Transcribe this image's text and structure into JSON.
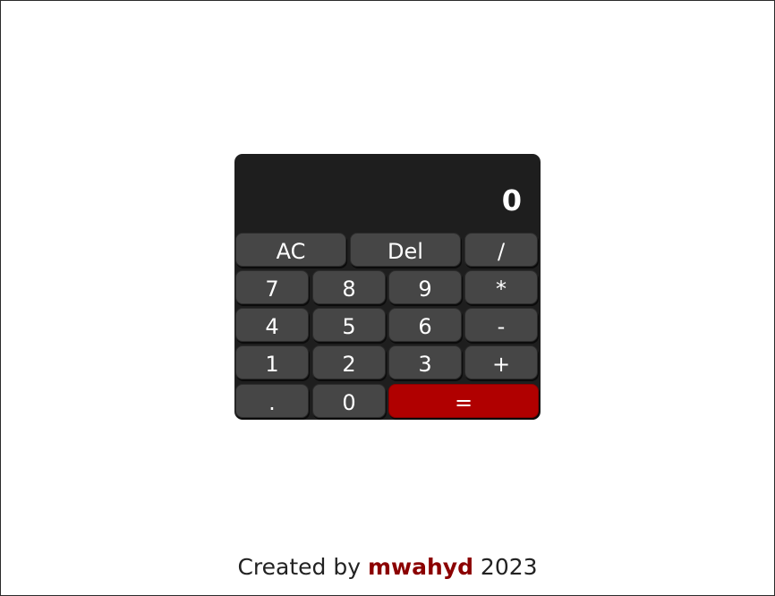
{
  "calculator": {
    "display": "0",
    "keys": {
      "clear": "AC",
      "delete": "Del",
      "divide": "/",
      "seven": "7",
      "eight": "8",
      "nine": "9",
      "multiply": "*",
      "four": "4",
      "five": "5",
      "six": "6",
      "subtract": "-",
      "one": "1",
      "two": "2",
      "three": "3",
      "add": "+",
      "decimal": ".",
      "zero": "0",
      "equals": "="
    }
  },
  "footer": {
    "prefix": "Created by",
    "author": "mwahyd",
    "year": "2023"
  },
  "colors": {
    "calculator_bg": "#1e1e1e",
    "key_bg": "#464646",
    "equals_bg": "#b00000",
    "author": "#8b0000"
  }
}
